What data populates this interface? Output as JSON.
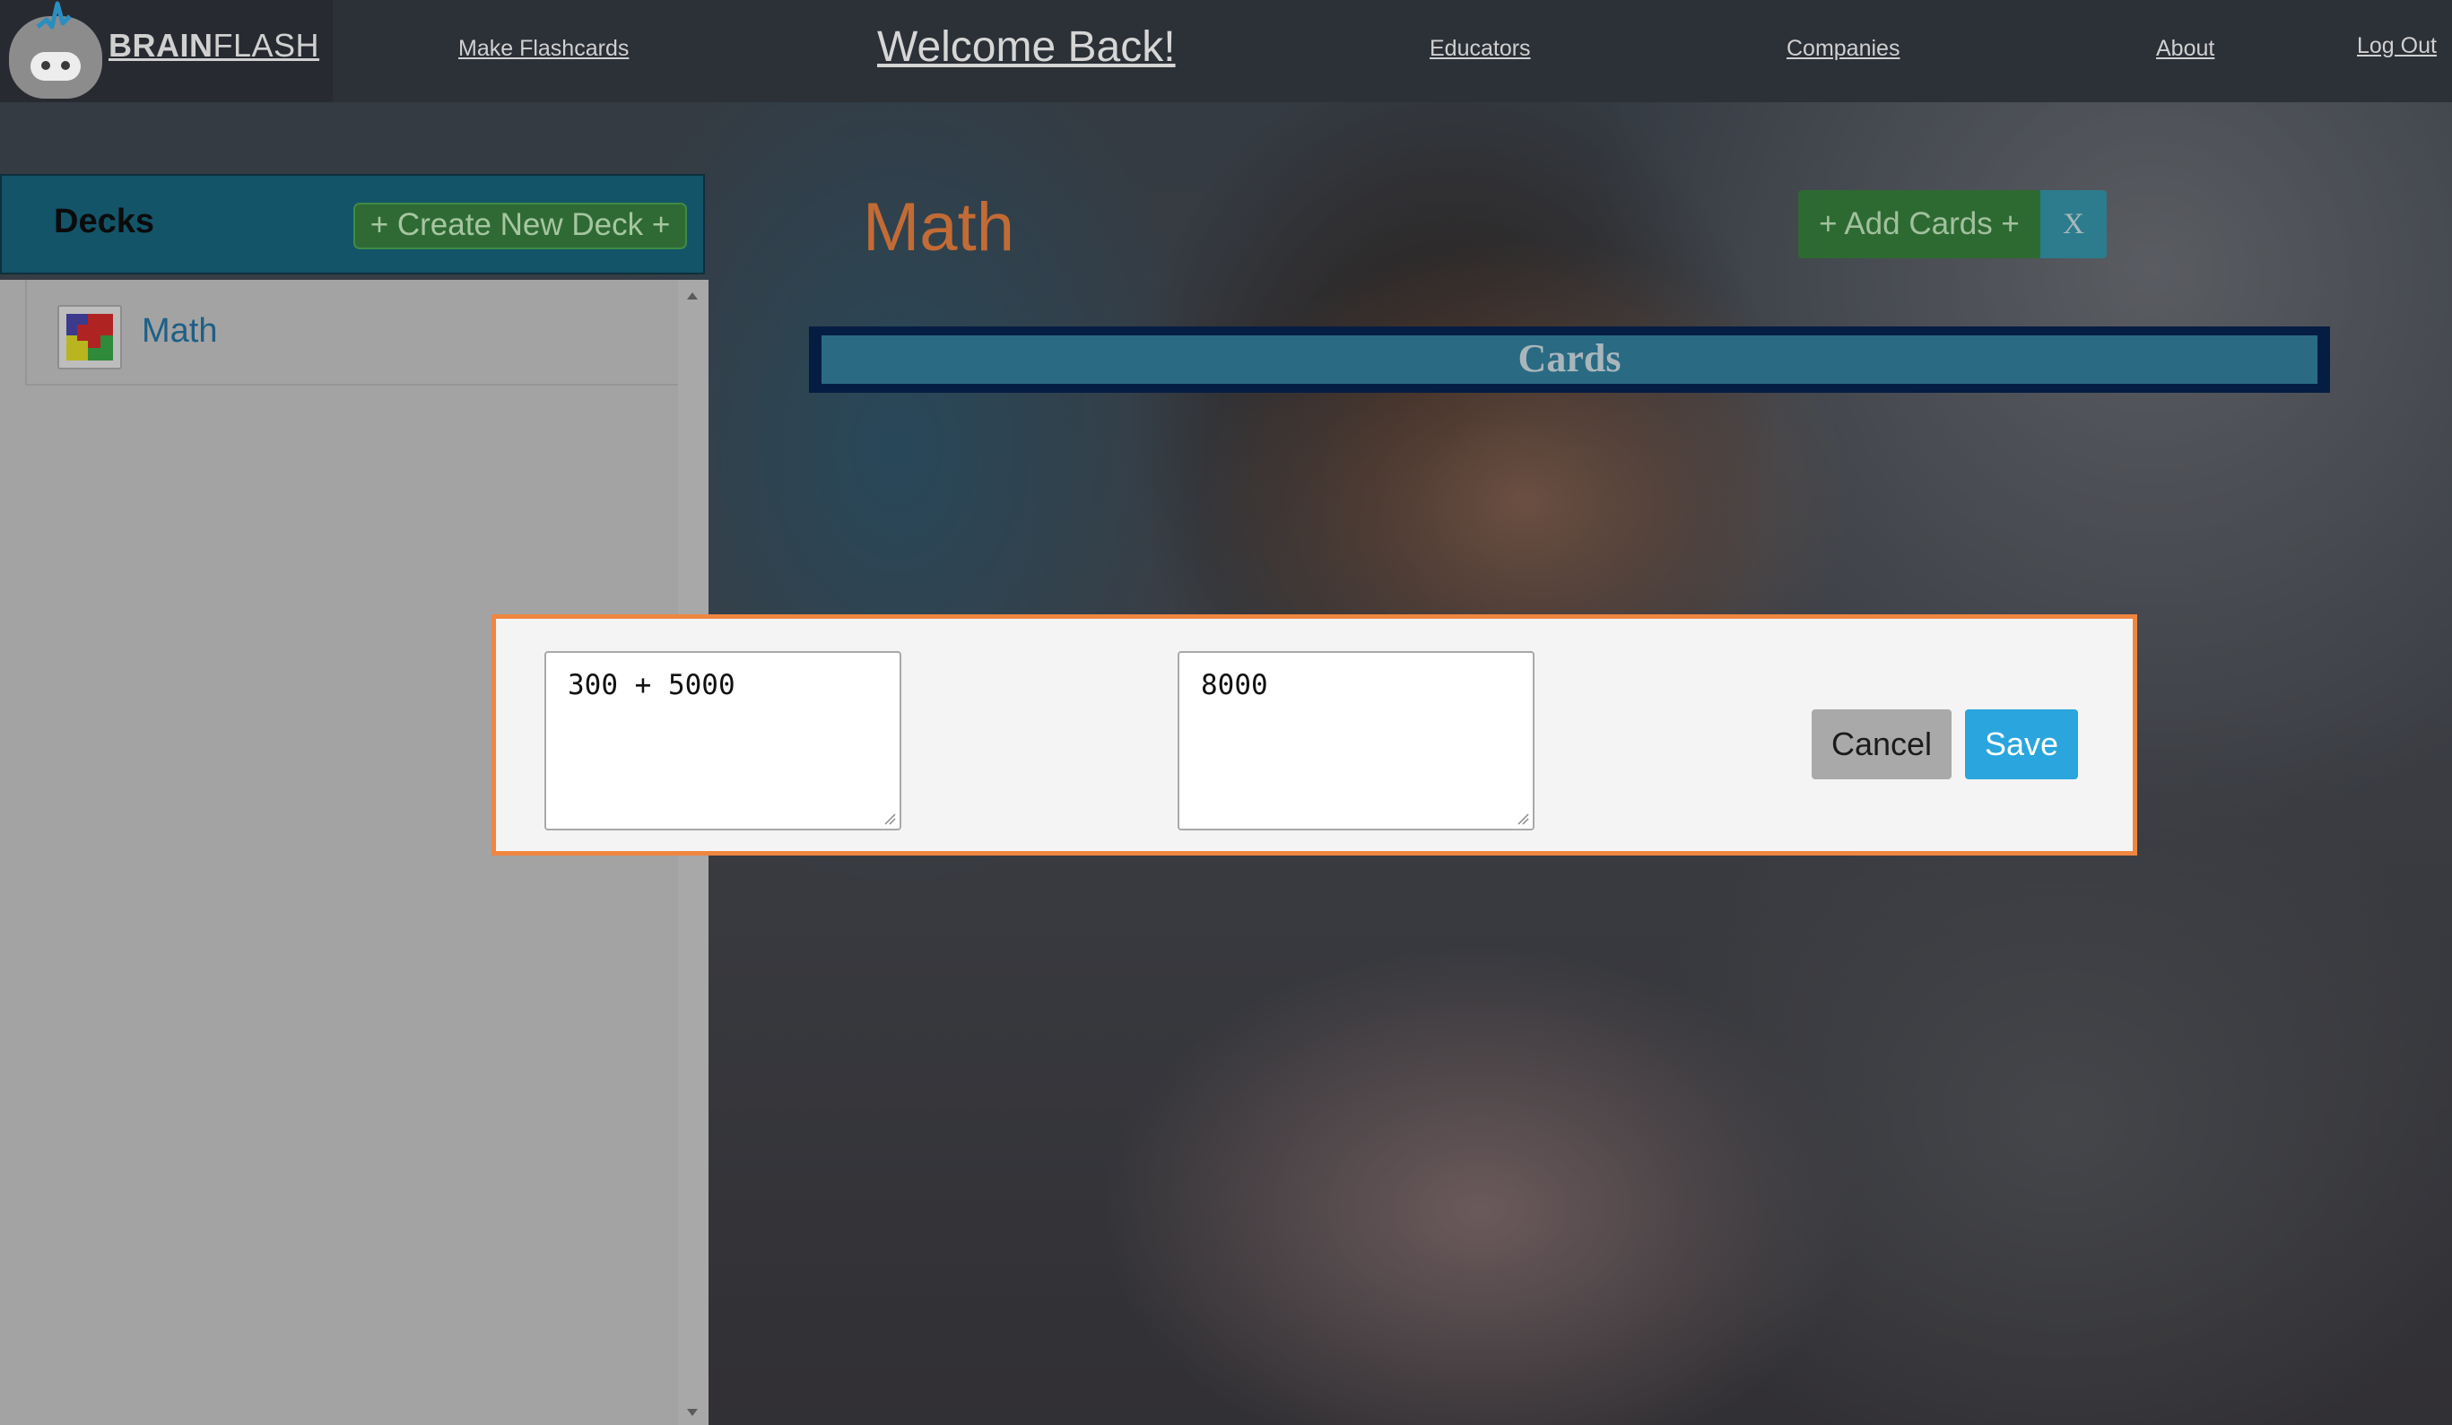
{
  "app": {
    "brand_bold": "BRAIN",
    "brand_light": "FLASH"
  },
  "nav": {
    "make_flashcards": "Make Flashcards",
    "welcome": "Welcome Back!",
    "educators": "Educators",
    "companies": "Companies",
    "about": "About",
    "logout": "Log Out"
  },
  "sidebar": {
    "title": "Decks",
    "create_button": "+ Create New Deck +",
    "decks": [
      {
        "name": "Math",
        "icon": "deck-thumbnail-icon"
      }
    ]
  },
  "main": {
    "deck_title": "Math",
    "add_cards_button": "+ Add Cards +",
    "close_button": "X",
    "cards_header": "Cards"
  },
  "edit_card": {
    "front_value": "300 + 5000",
    "back_value": "8000",
    "cancel_label": "Cancel",
    "save_label": "Save"
  },
  "colors": {
    "accent_orange": "#ef8640",
    "save_blue": "#2aa5de",
    "add_green": "#2d6a32",
    "header_teal": "#135468"
  }
}
